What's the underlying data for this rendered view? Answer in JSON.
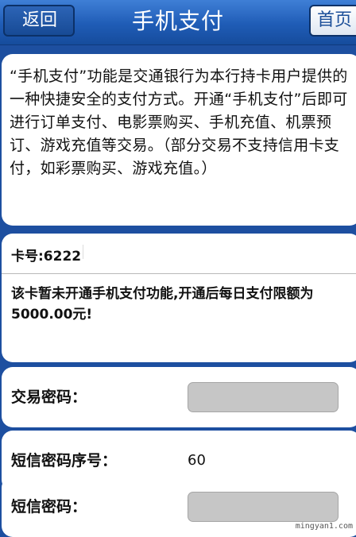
{
  "header": {
    "title": "手机支付",
    "back_label": "返回",
    "home_label": "首页"
  },
  "intro": {
    "text": "“手机支付”功能是交通银行为本行持卡用户提供的一种快捷安全的支付方式。开通“手机支付”后即可进行订单支付、电影票购买、手机充值、机票预订、游戏充值等交易。（部分交易不支持信用卡支付，如彩票购买、游戏充值。）"
  },
  "card": {
    "number_label": "卡号:6222",
    "notice": "该卡暂未开通手机支付功能,开通后每日支付限额为5000.00元!"
  },
  "form": {
    "trade_password_label": "交易密码：",
    "sms_seq_label": "短信密码序号：",
    "sms_seq_value": "60",
    "sms_password_label": "短信密码："
  },
  "watermark": "mingyan1.com"
}
